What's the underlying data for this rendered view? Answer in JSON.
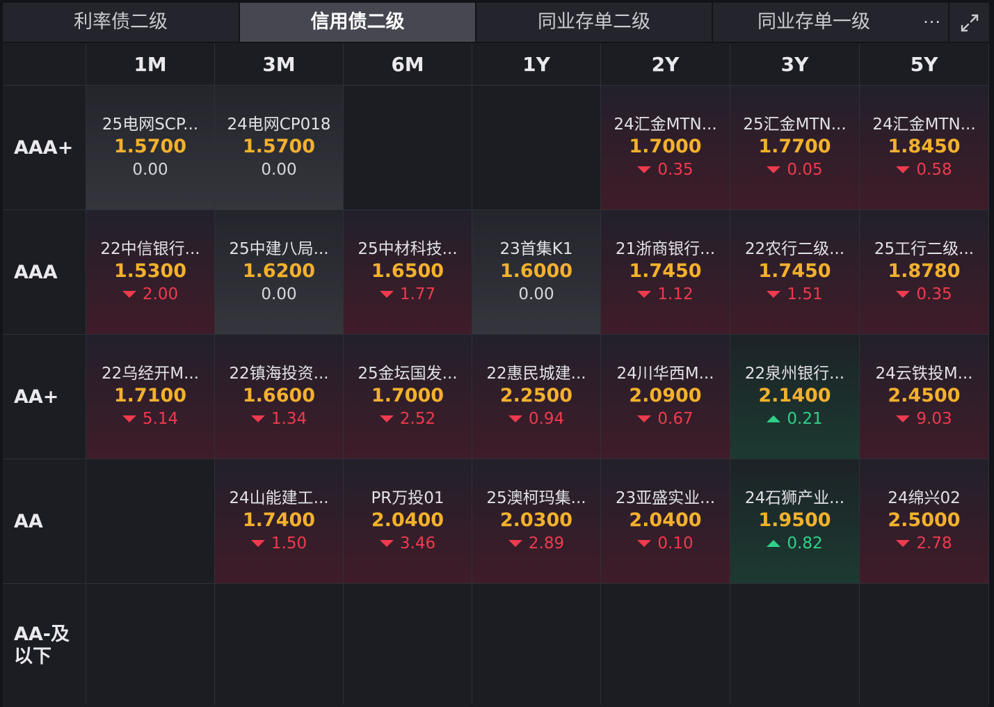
{
  "tabs": [
    {
      "label": "利率债二级",
      "active": false
    },
    {
      "label": "信用债二级",
      "active": true
    },
    {
      "label": "同业存单二级",
      "active": false
    },
    {
      "label": "同业存单一级",
      "active": false
    }
  ],
  "more_label": "···",
  "columns": [
    "1M",
    "3M",
    "6M",
    "1Y",
    "2Y",
    "3Y",
    "5Y"
  ],
  "rows": [
    {
      "label": "AAA+",
      "cells": [
        {
          "name": "25电网SCP...",
          "yield": "1.5700",
          "change": "0.00",
          "dir": "flat"
        },
        {
          "name": "24电网CP018",
          "yield": "1.5700",
          "change": "0.00",
          "dir": "flat"
        },
        null,
        null,
        {
          "name": "24汇金MTN...",
          "yield": "1.7000",
          "change": "0.35",
          "dir": "down"
        },
        {
          "name": "25汇金MTN...",
          "yield": "1.7700",
          "change": "0.05",
          "dir": "down"
        },
        {
          "name": "24汇金MTN...",
          "yield": "1.8450",
          "change": "0.58",
          "dir": "down"
        }
      ]
    },
    {
      "label": "AAA",
      "cells": [
        {
          "name": "22中信银行...",
          "yield": "1.5300",
          "change": "2.00",
          "dir": "down"
        },
        {
          "name": "25中建八局...",
          "yield": "1.6200",
          "change": "0.00",
          "dir": "flat"
        },
        {
          "name": "25中材科技...",
          "yield": "1.6500",
          "change": "1.77",
          "dir": "down"
        },
        {
          "name": "23首集K1",
          "yield": "1.6000",
          "change": "0.00",
          "dir": "flat"
        },
        {
          "name": "21浙商银行...",
          "yield": "1.7450",
          "change": "1.12",
          "dir": "down"
        },
        {
          "name": "22农行二级...",
          "yield": "1.7450",
          "change": "1.51",
          "dir": "down"
        },
        {
          "name": "25工行二级...",
          "yield": "1.8780",
          "change": "0.35",
          "dir": "down"
        }
      ]
    },
    {
      "label": "AA+",
      "cells": [
        {
          "name": "22乌经开M...",
          "yield": "1.7100",
          "change": "5.14",
          "dir": "down"
        },
        {
          "name": "22镇海投资...",
          "yield": "1.6600",
          "change": "1.34",
          "dir": "down"
        },
        {
          "name": "25金坛国发...",
          "yield": "1.7000",
          "change": "2.52",
          "dir": "down"
        },
        {
          "name": "22惠民城建...",
          "yield": "2.2500",
          "change": "0.94",
          "dir": "down"
        },
        {
          "name": "24川华西M...",
          "yield": "2.0900",
          "change": "0.67",
          "dir": "down"
        },
        {
          "name": "22泉州银行...",
          "yield": "2.1400",
          "change": "0.21",
          "dir": "up"
        },
        {
          "name": "24云铁投M...",
          "yield": "2.4500",
          "change": "9.03",
          "dir": "down"
        }
      ]
    },
    {
      "label": "AA",
      "cells": [
        null,
        {
          "name": "24山能建工...",
          "yield": "1.7400",
          "change": "1.50",
          "dir": "down"
        },
        {
          "name": "PR万投01",
          "yield": "2.0400",
          "change": "3.46",
          "dir": "down"
        },
        {
          "name": "25澳柯玛集...",
          "yield": "2.0300",
          "change": "2.89",
          "dir": "down"
        },
        {
          "name": "23亚盛实业...",
          "yield": "2.0400",
          "change": "0.10",
          "dir": "down"
        },
        {
          "name": "24石狮产业...",
          "yield": "1.9500",
          "change": "0.82",
          "dir": "up"
        },
        {
          "name": "24绵兴02",
          "yield": "2.5000",
          "change": "2.78",
          "dir": "down"
        }
      ]
    },
    {
      "label": "AA-及以下",
      "label_lines": [
        "AA-及",
        "以下"
      ],
      "cells": [
        null,
        null,
        null,
        null,
        null,
        null,
        null
      ]
    }
  ]
}
